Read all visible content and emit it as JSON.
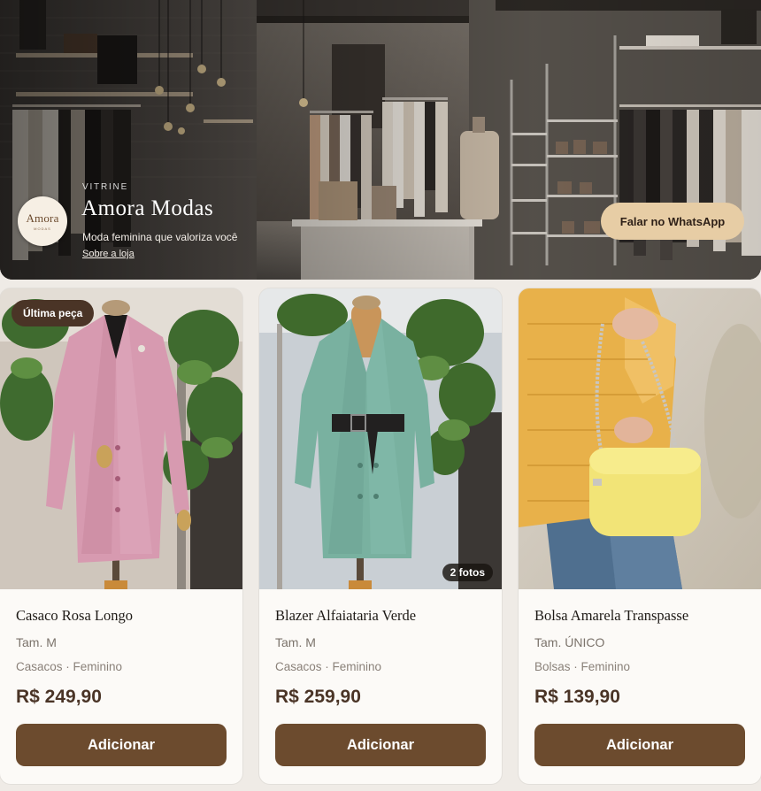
{
  "hero": {
    "kicker": "VITRINE",
    "store_name": "Amora Modas",
    "tagline": "Moda feminina que valoriza você",
    "about_link": "Sobre a loja",
    "whatsapp_button": "Falar no WhatsApp",
    "logo": {
      "word": "Amora",
      "sub": "MODAS"
    }
  },
  "products": [
    {
      "name": "Casaco Rosa Longo",
      "size": "Tam. M",
      "categories": "Casacos · Feminino",
      "price": "R$ 249,90",
      "badge": "Última peça",
      "button": "Adicionar"
    },
    {
      "name": "Blazer Alfaiataria Verde",
      "size": "Tam. M",
      "categories": "Casacos · Feminino",
      "price": "R$ 259,90",
      "photo_count": "2 fotos",
      "button": "Adicionar"
    },
    {
      "name": "Bolsa Amarela Transpasse",
      "size": "Tam. ÚNICO",
      "categories": "Bolsas · Feminino",
      "price": "R$ 139,90",
      "button": "Adicionar"
    }
  ],
  "colors": {
    "accent": "#6c4b2e",
    "price": "#4a3426",
    "whatsapp_button": "#e7cda5",
    "badge": "#4a3426"
  }
}
